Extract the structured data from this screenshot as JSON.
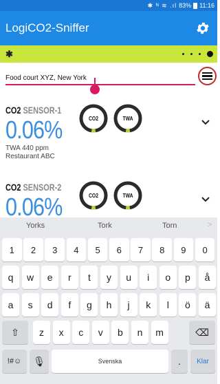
{
  "status_bar": {
    "icons": "✱ ᴺ ≋ .ıl",
    "battery": "83%",
    "time": "11:16"
  },
  "app_bar": {
    "title": "LogiCO2-Sniffer",
    "settings_icon": "gear-icon"
  },
  "connection_bar": {
    "bluetooth_icon": "bluetooth-icon",
    "bluetooth_glyph": "✱",
    "accent": "#c8e63c"
  },
  "location": {
    "value": "Food court XYZ, New York",
    "menu_icon": "hamburger-menu-icon"
  },
  "sensors": [
    {
      "gas": "CO2",
      "name": "SENSOR-1",
      "value": "0.06%",
      "twa": "TWA 440 ppm",
      "location": "Restaurant ABC",
      "gauges": [
        {
          "label": "CO2",
          "fill": 0.05
        },
        {
          "label": "TWA",
          "fill": 0.05
        }
      ]
    },
    {
      "gas": "CO2",
      "name": "SENSOR-2",
      "value": "0.06%",
      "twa": "",
      "location": "",
      "gauges": [
        {
          "label": "CO2",
          "fill": 0.05
        },
        {
          "label": "TWA",
          "fill": 0.05
        }
      ]
    }
  ],
  "keyboard": {
    "suggestions": [
      "Yorks",
      "Tork",
      "Torn"
    ],
    "suggest_more": ">",
    "row_numbers": [
      "1",
      "2",
      "3",
      "4",
      "5",
      "6",
      "7",
      "8",
      "9",
      "0"
    ],
    "row1": [
      "q",
      "w",
      "e",
      "r",
      "t",
      "y",
      "u",
      "i",
      "o",
      "p",
      "å"
    ],
    "row2": [
      "a",
      "s",
      "d",
      "f",
      "g",
      "h",
      "j",
      "k",
      "l",
      "ö",
      "ä"
    ],
    "row3": [
      "z",
      "x",
      "c",
      "v",
      "b",
      "n",
      "m"
    ],
    "shift": "⇧",
    "backspace": "⌫",
    "symbols": "!#☺",
    "mic": "🎙",
    "space": "Svenska",
    "period": ".",
    "enter": "Klar"
  },
  "colors": {
    "app_bar": "#1e88e5",
    "status_bar": "#1976d2",
    "value_blue": "#3b8fe0",
    "gauge_green": "#b5d334",
    "cursor_pink": "#d81b60"
  }
}
